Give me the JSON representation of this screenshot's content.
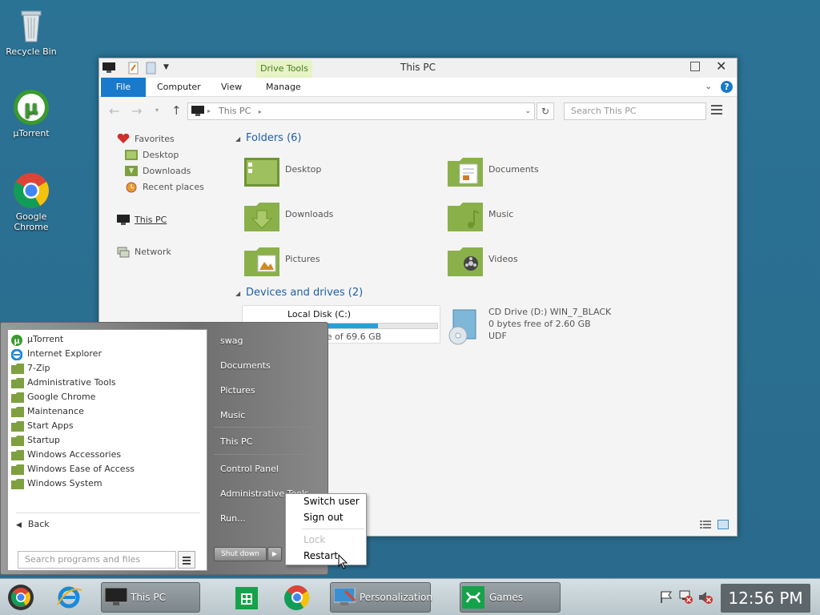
{
  "desktop": {
    "icons": [
      {
        "label": "Recycle Bin",
        "icon": "recycle-bin-icon"
      },
      {
        "label": "µTorrent",
        "icon": "utorrent-icon"
      },
      {
        "label": "Google Chrome",
        "icon": "chrome-icon"
      }
    ]
  },
  "explorer": {
    "title": "This PC",
    "drive_tools": "Drive Tools",
    "ribbon_tabs": [
      "File",
      "Computer",
      "View",
      "Manage"
    ],
    "address": "This PC",
    "search_placeholder": "Search This PC",
    "nav": {
      "favorites": "Favorites",
      "desktop": "Desktop",
      "downloads": "Downloads",
      "recent": "Recent places",
      "thispc": "This PC",
      "network": "Network"
    },
    "folders_header": "Folders (6)",
    "folders": [
      {
        "label": "Desktop"
      },
      {
        "label": "Documents"
      },
      {
        "label": "Downloads"
      },
      {
        "label": "Music"
      },
      {
        "label": "Pictures"
      },
      {
        "label": "Videos"
      }
    ],
    "drives_header": "Devices and drives (2)",
    "drives": [
      {
        "name": "Local Disk (C:)",
        "free": "ee of 69.6 GB",
        "used_fraction": 0.6
      },
      {
        "name": "CD Drive (D:) WIN_7_BLACK",
        "free": "0 bytes free of 2.60 GB",
        "fs": "UDF"
      }
    ]
  },
  "startmenu": {
    "programs": [
      "µTorrent",
      "Internet Explorer",
      "7-Zip",
      "Administrative Tools",
      "Google Chrome",
      "Maintenance",
      "Start Apps",
      "Startup",
      "Windows Accessories",
      "Windows Ease of Access",
      "Windows System"
    ],
    "back": "Back",
    "search_placeholder": "Search programs and files",
    "right": [
      "swag",
      "Documents",
      "Pictures",
      "Music",
      "This PC",
      "Control Panel",
      "Administrative Tools",
      "Run..."
    ],
    "shutdown": "Shut down"
  },
  "context_menu": {
    "items": [
      "Switch user",
      "Sign out",
      "Lock",
      "Restart"
    ]
  },
  "taskbar": {
    "tasks": [
      "This PC",
      "Personalization",
      "Games"
    ],
    "clock": "12:56 PM"
  },
  "colors": {
    "desktop_bg": "#2b7395",
    "accent": "#1979ca",
    "folder_green": "#8ab04a"
  }
}
